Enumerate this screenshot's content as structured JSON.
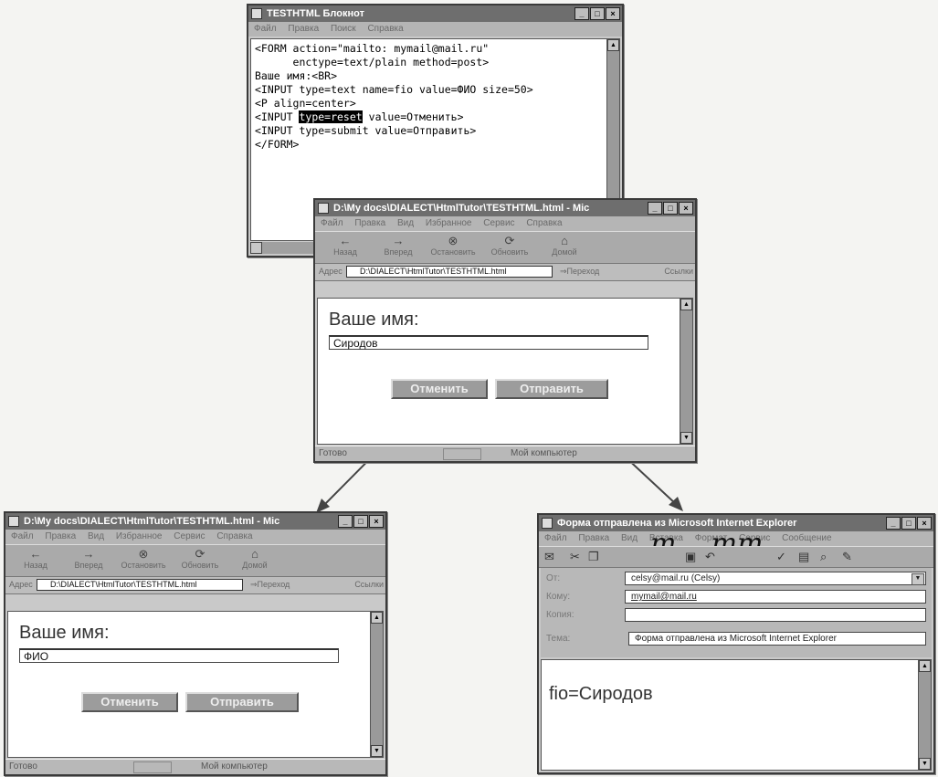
{
  "notepad": {
    "title": "TESTHTML  Блокнот",
    "menu": [
      "Файл",
      "Правка",
      "Поиск",
      "Справка"
    ],
    "code_lines": [
      "<FORM action=\"mailto: mymail@mail.ru\"",
      "      enctype=text/plain method=post>",
      "",
      "Ваше имя:<BR>",
      "<INPUT type=text name=fio value=ФИО size=50>",
      "",
      "<P align=center>"
    ],
    "line8_pre": "<INPUT ",
    "line8_sel": "type=reset",
    "line8_post": " value=Отменить>",
    "line9": "<INPUT type=submit value=Отправить>",
    "line10": "",
    "line11": "</FORM>"
  },
  "browser_title": "D:\\My docs\\DIALECT\\HtmlTutor\\TESTHTML.html - Mic",
  "browser_menu": [
    "Файл",
    "Правка",
    "Вид",
    "Избранное",
    "Сервис",
    "Справка"
  ],
  "toolbar": {
    "back": "Назад",
    "forward": "Вперед",
    "stop": "Остановить",
    "refresh": "Обновить",
    "home": "Домой"
  },
  "address": {
    "label": "Адрес",
    "url": "D:\\DIALECT\\HtmlTutor\\TESTHTML.html",
    "go": "Переход",
    "links": "Ссылки"
  },
  "status": {
    "ready": "Готово",
    "zone": "Мой компьютер"
  },
  "form": {
    "label": "Ваше имя:",
    "reset": "Отменить",
    "submit": "Отправить"
  },
  "browser_center": {
    "input_value": "Сиродов"
  },
  "browser_left": {
    "input_value": "ФИО"
  },
  "mail": {
    "title": "Форма отправлена из Microsoft Internet Explorer",
    "menu": [
      "Файл",
      "Правка",
      "Вид",
      "Вставка",
      "Формат",
      "Сервис",
      "Сообщение"
    ],
    "overlay_text": "m.   mm",
    "from_label": "От:",
    "from_value": "celsy@mail.ru  (Celsy)",
    "to_label": "Кому:",
    "to_value": "mymail@mail.ru",
    "cc_label": "Копия:",
    "cc_value": "",
    "subject_label": "Тема:",
    "subject_value": "Форма отправлена из Microsoft Internet Explorer",
    "body": "fio=Сиродов"
  }
}
